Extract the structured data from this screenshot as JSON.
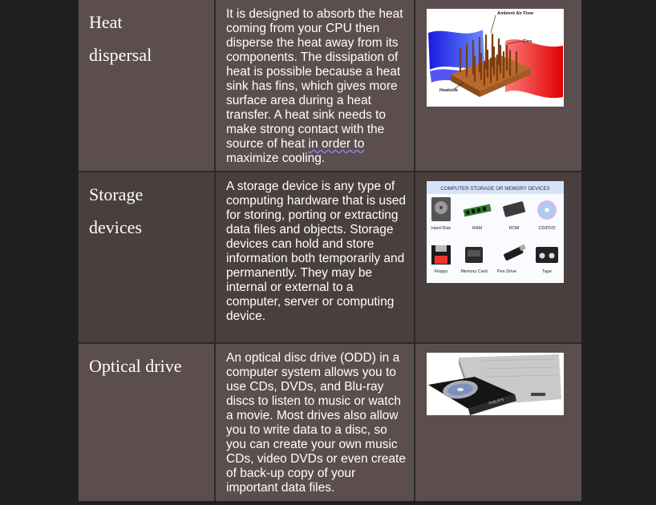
{
  "rows": [
    {
      "term": "Heat dispersal",
      "term_line1": "Heat",
      "term_line2": "dispersal",
      "description_main": "It is designed to absorb the heat coming from your CPU then disperse the heat away from its components. The dissipation of heat is possible because a heat sink has fins, which gives more surface area during a heat transfer. A heat sink needs to make strong contact with the source of heat ",
      "description_underlined": "in order to",
      "description_tail": " maximize cooling.",
      "image": {
        "icon": "heatsink-diagram",
        "labels": [
          "Ambient Air Flow",
          "Fins",
          "Heatsink"
        ]
      }
    },
    {
      "term": "Storage devices",
      "term_line1": "Storage",
      "term_line2": "devices",
      "description": "A storage device is any type of computing hardware that is used for storing, porting or extracting data files and objects. Storage devices can hold and store information both temporarily and permanently. They may be internal or external to a computer, server or computing device.",
      "image": {
        "icon": "storage-devices-chart",
        "title": "COMPUTER STORAGE OR MEMORY DEVICES",
        "items": [
          "Hard Disk",
          "RAM",
          "ROM",
          "CD/DVD",
          "Floppy",
          "Memory Card",
          "Pen Drive",
          "Tape"
        ]
      }
    },
    {
      "term": "Optical drive",
      "description": "An optical disc drive (ODD) in a computer system allows you to use CDs, DVDs, and Blu-ray discs to listen to music or watch a movie. Most drives also allow you to write data to a disc, so you can create your own music CDs, video DVDs or even create of back-up copy of your important data files.",
      "image": {
        "icon": "optical-drive-photo",
        "brand": "PHILIPS"
      }
    }
  ],
  "colors": {
    "page_background": "#1f1f1f",
    "cell_dark": "#5c4e4e",
    "cell_mid": "#4a3f3f",
    "text": "#ffffff"
  }
}
